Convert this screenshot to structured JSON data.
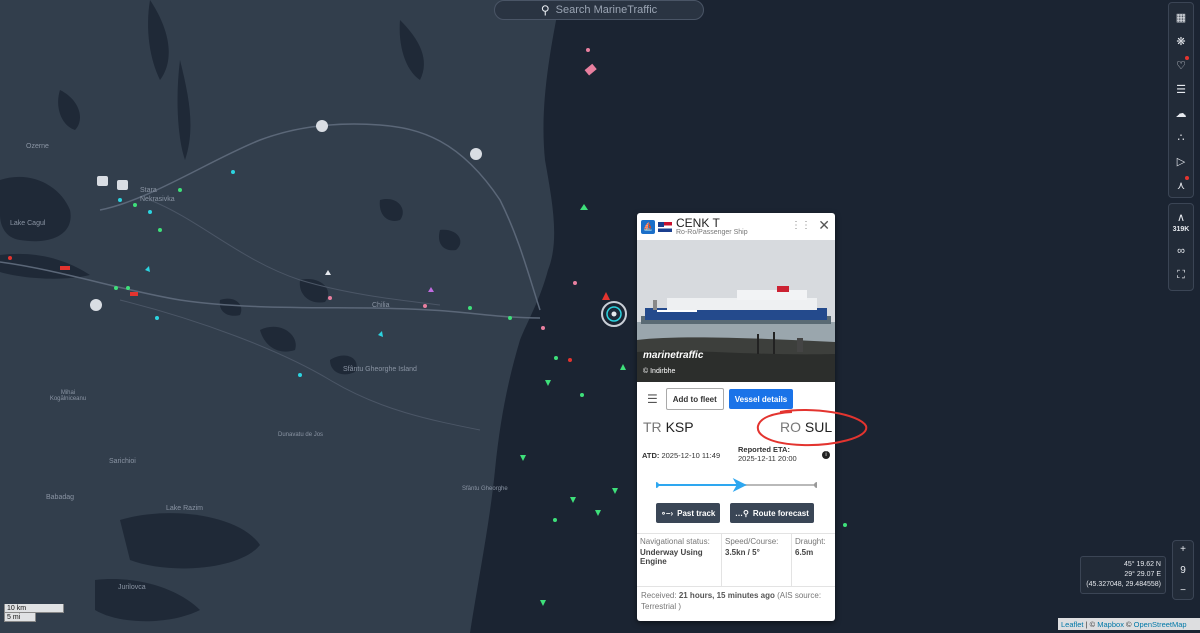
{
  "search": {
    "placeholder": "Search MarineTraffic"
  },
  "map_labels": [
    {
      "text": "Ozerne"
    },
    {
      "text": "Lake Cagul"
    },
    {
      "text": "Stara Nekrasivka"
    },
    {
      "text": "Chilia"
    },
    {
      "text": "Sfântu Gheorghe Island"
    },
    {
      "text": "Dunavatu de Jos"
    },
    {
      "text": "Sarichioi"
    },
    {
      "text": "Babadag"
    },
    {
      "text": "Lake Razim"
    },
    {
      "text": "Jurilovca"
    },
    {
      "text": "Mihai Kogălniceanu"
    },
    {
      "text": "Sfântu Gheorghe"
    }
  ],
  "right_toolbar": {
    "icons": [
      "map-icon",
      "filter-icon",
      "heart-icon",
      "layers-icon",
      "weather-icon",
      "density-icon",
      "play-icon",
      "measure-icon"
    ],
    "vessel_count": "319K",
    "infinity": "∞",
    "fullscreen": "⛶"
  },
  "zoom": {
    "plus": "+",
    "level": "9",
    "minus": "−"
  },
  "coords": {
    "lat": "45° 19.62 N",
    "lon": "29° 29.07 E",
    "decimal": "(45.327048, 29.484558)"
  },
  "attribution": {
    "leaflet": "Leaflet",
    "sep": " | © ",
    "mapbox": "Mapbox",
    "sep2": " © ",
    "osm": "OpenStreetMap"
  },
  "scale": {
    "km": "10 km",
    "mi": "5 mi"
  },
  "vessel": {
    "name": "CENK T",
    "type": "Ro-Ro/Passenger Ship",
    "photo_watermark": "marinetraffic",
    "photo_credit": "© Indirbhe",
    "add_fleet": "Add to fleet",
    "details": "Vessel details",
    "departure": {
      "cc": "TR",
      "code": "KSP"
    },
    "arrival": {
      "cc": "RO",
      "code": "SUL"
    },
    "atd_label": "ATD:",
    "atd_value": "2025-12-10 11:49",
    "eta_label": "Reported ETA:",
    "eta_value": "2025-12-11 20:00",
    "progress": 0.52,
    "past_track": "Past track",
    "route_forecast": "Route forecast",
    "nav_status_label": "Navigational status:",
    "nav_status_value": "Underway Using Engine",
    "speed_label": "Speed/Course:",
    "speed_value": "3.5kn / 5°",
    "draught_label": "Draught:",
    "draught_value": "6.5m",
    "received_label": "Received:",
    "received_value": "21 hours, 15 minutes ago",
    "received_source": "(AIS source: Terrestrial )"
  },
  "colors": {
    "accent": "#1a73e8",
    "annotation": "#e3342f",
    "track": "#2ea7f0"
  }
}
